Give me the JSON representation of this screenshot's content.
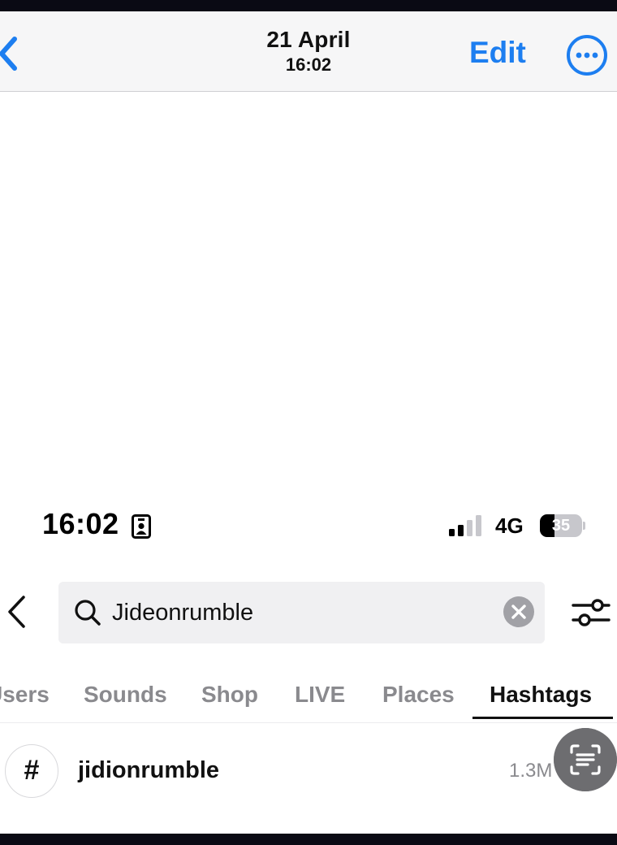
{
  "viewer": {
    "date": "21 April",
    "time": "16:02",
    "edit_label": "Edit",
    "back_icon": "chevron-left-icon",
    "more_icon": "ellipsis-circle-icon",
    "accent_color": "#1d7ef0"
  },
  "status_bar": {
    "time": "16:02",
    "network": "4G",
    "battery": "35",
    "battery_level": 0.35,
    "signal_bars_filled": 2,
    "signal_bars_total": 4
  },
  "search": {
    "value": "Jideonrumble",
    "back_icon": "chevron-left-icon",
    "search_icon": "search-icon",
    "clear_icon": "clear-icon",
    "filter_icon": "filter-sliders-icon"
  },
  "tabs": [
    {
      "label": "Users",
      "active": false
    },
    {
      "label": "Sounds",
      "active": false
    },
    {
      "label": "Shop",
      "active": false
    },
    {
      "label": "LIVE",
      "active": false
    },
    {
      "label": "Places",
      "active": false
    },
    {
      "label": "Hashtags",
      "active": true
    }
  ],
  "results": [
    {
      "icon_text": "#",
      "title": "jidionrumble",
      "count": "1.3M"
    }
  ],
  "live_text_icon": "live-text-scan-icon"
}
